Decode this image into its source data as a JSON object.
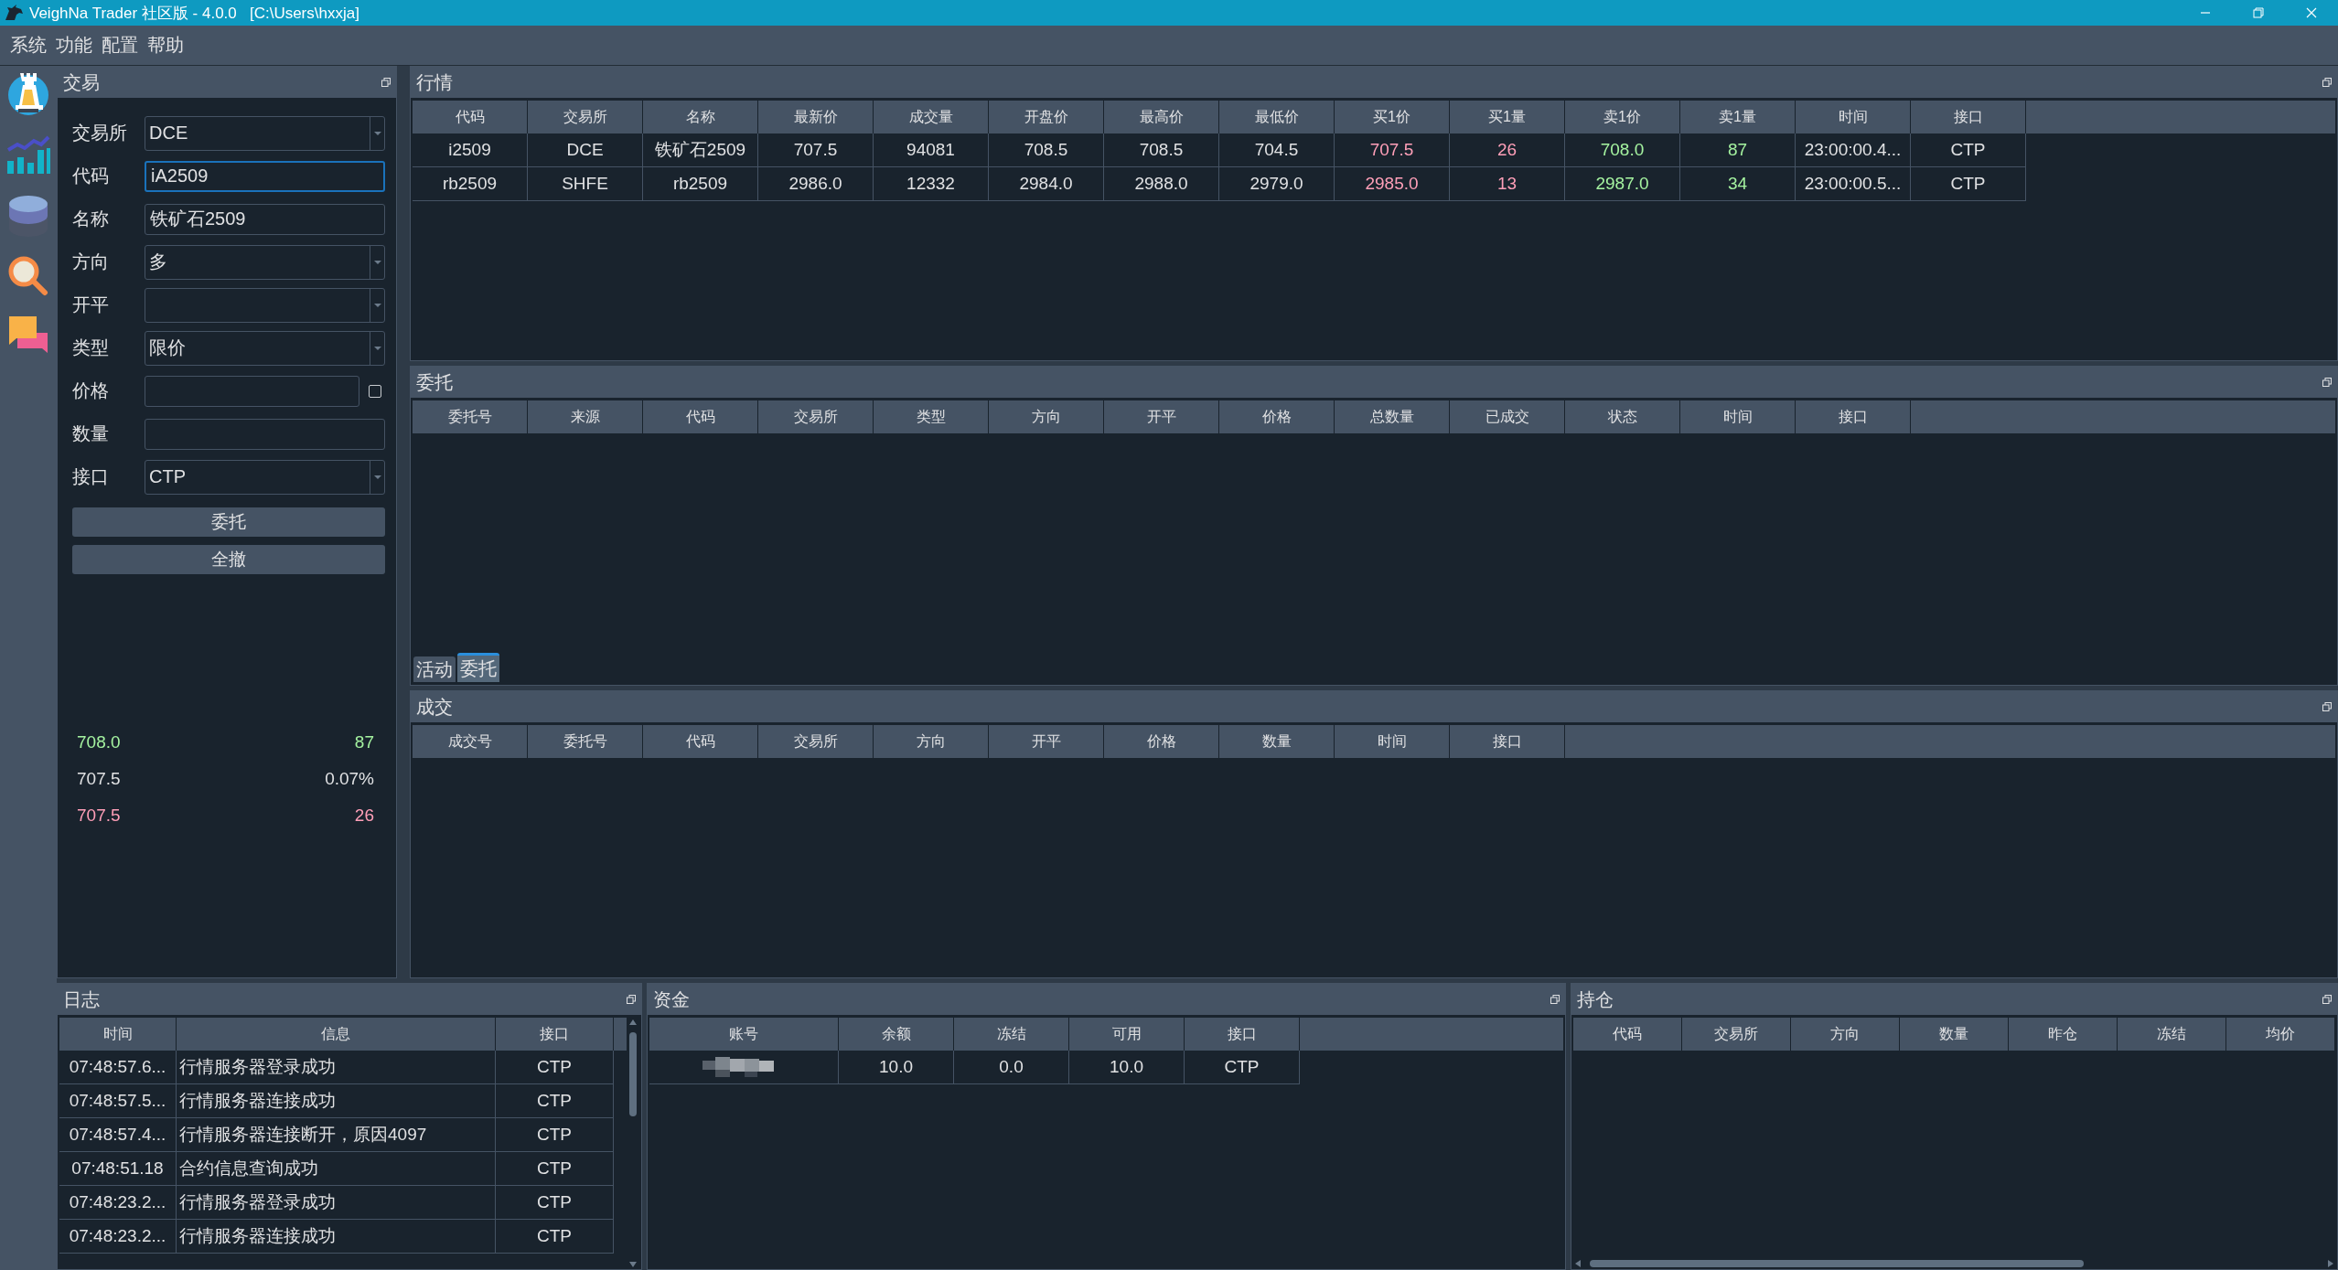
{
  "window": {
    "title": "VeighNa Trader 社区版 - 4.0.0   [C:\\Users\\hxxja]"
  },
  "menu": [
    "系统",
    "功能",
    "配置",
    "帮助"
  ],
  "trade_panel": {
    "title": "交易",
    "fields": [
      {
        "label": "交易所",
        "kind": "combo",
        "value": "DCE",
        "focused": false
      },
      {
        "label": "代码",
        "kind": "input",
        "value": "iA2509",
        "focused": true
      },
      {
        "label": "名称",
        "kind": "input",
        "value": "铁矿石2509",
        "focused": false
      },
      {
        "label": "方向",
        "kind": "combo",
        "value": "多",
        "focused": false
      },
      {
        "label": "开平",
        "kind": "combo",
        "focused": false
      },
      {
        "label": "类型",
        "kind": "combo",
        "value": "限价",
        "focused": false
      },
      {
        "label": "价格",
        "kind": "check_input",
        "checked": false,
        "focused": false
      },
      {
        "label": "数量",
        "kind": "input",
        "focused": false
      },
      {
        "label": "接口",
        "kind": "combo",
        "value": "CTP",
        "focused": false
      }
    ],
    "buttons": [
      "委托",
      "全撤"
    ],
    "depth": [
      {
        "kind": "ask",
        "price": "708.0",
        "volume": "87"
      },
      {
        "kind": "last",
        "price": "707.5",
        "volume": "0.07%"
      },
      {
        "kind": "bid",
        "price": "707.5",
        "volume": "26"
      }
    ]
  },
  "market": {
    "title": "行情",
    "columns": [
      {
        "label": "代码",
        "kind": "plain"
      },
      {
        "label": "交易所",
        "kind": "plain"
      },
      {
        "label": "名称",
        "kind": "plain"
      },
      {
        "label": "最新价",
        "kind": "plain"
      },
      {
        "label": "成交量",
        "kind": "plain"
      },
      {
        "label": "开盘价",
        "kind": "plain"
      },
      {
        "label": "最高价",
        "kind": "plain"
      },
      {
        "label": "最低价",
        "kind": "plain"
      },
      {
        "label": "买1价",
        "kind": "bid"
      },
      {
        "label": "买1量",
        "kind": "bid"
      },
      {
        "label": "卖1价",
        "kind": "ask"
      },
      {
        "label": "卖1量",
        "kind": "ask"
      },
      {
        "label": "时间",
        "kind": "plain"
      },
      {
        "label": "接口",
        "kind": "plain"
      }
    ],
    "rows": [
      [
        "i2509",
        "DCE",
        "铁矿石2509",
        "707.5",
        "94081",
        "708.5",
        "708.5",
        "704.5",
        "707.5",
        "26",
        "708.0",
        "87",
        "23:00:00.4...",
        "CTP"
      ],
      [
        "rb2509",
        "SHFE",
        "rb2509",
        "2986.0",
        "12332",
        "2984.0",
        "2988.0",
        "2979.0",
        "2985.0",
        "13",
        "2987.0",
        "34",
        "23:00:00.5...",
        "CTP"
      ]
    ]
  },
  "orders": {
    "title": "委托",
    "columns": [
      "委托号",
      "来源",
      "代码",
      "交易所",
      "类型",
      "方向",
      "开平",
      "价格",
      "总数量",
      "已成交",
      "状态",
      "时间",
      "接口"
    ],
    "tabs": [
      {
        "label": "活动",
        "selected": false
      },
      {
        "label": "委托",
        "selected": true
      }
    ]
  },
  "trades": {
    "title": "成交",
    "columns": [
      "成交号",
      "委托号",
      "代码",
      "交易所",
      "方向",
      "开平",
      "价格",
      "数量",
      "时间",
      "接口"
    ]
  },
  "log": {
    "title": "日志",
    "columns": [
      {
        "label": "时间",
        "kind": "center"
      },
      {
        "label": "信息",
        "kind": "text"
      },
      {
        "label": "接口",
        "kind": "center"
      }
    ],
    "rows": [
      [
        "07:48:57.6...",
        "行情服务器登录成功",
        "CTP"
      ],
      [
        "07:48:57.5...",
        "行情服务器连接成功",
        "CTP"
      ],
      [
        "07:48:57.4...",
        "行情服务器连接断开，原因4097",
        "CTP"
      ],
      [
        "07:48:51.18",
        "合约信息查询成功",
        "CTP"
      ],
      [
        "07:48:23.2...",
        "行情服务器登录成功",
        "CTP"
      ],
      [
        "07:48:23.2...",
        "行情服务器连接成功",
        "CTP"
      ]
    ]
  },
  "funds": {
    "title": "资金",
    "columns": [
      "账号",
      "余额",
      "冻结",
      "可用",
      "接口"
    ],
    "rows": [
      [
        {
          "kind": "masked"
        },
        "10.0",
        "0.0",
        "10.0",
        "CTP"
      ]
    ]
  },
  "positions": {
    "title": "持仓",
    "columns": [
      "代码",
      "交易所",
      "方向",
      "数量",
      "昨仓",
      "冻结",
      "均价"
    ]
  }
}
